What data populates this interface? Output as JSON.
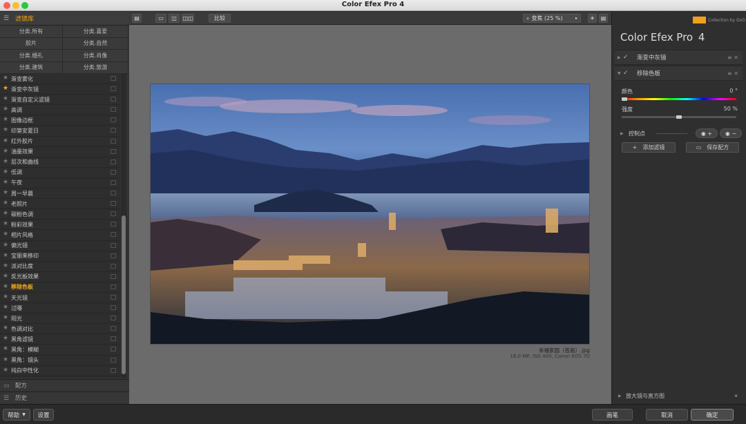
{
  "window": {
    "title": "Color Efex Pro 4"
  },
  "library": {
    "header": "滤镜库",
    "categories": [
      "分类.所有",
      "分类.喜爱",
      "胶片",
      "分类.自然",
      "分类.婚礼",
      "分类.肖像",
      "分类.建筑",
      "分类.旅游"
    ],
    "filters": [
      {
        "name": "渐变雾化",
        "fav": false
      },
      {
        "name": "渐变中灰镜",
        "fav": true
      },
      {
        "name": "渐变自定义滤镜",
        "fav": false
      },
      {
        "name": "高调",
        "fav": false
      },
      {
        "name": "图像边框",
        "fav": false
      },
      {
        "name": "印第安夏日",
        "fav": false
      },
      {
        "name": "红外胶片",
        "fav": false
      },
      {
        "name": "油墨效果",
        "fav": false
      },
      {
        "name": "层次和曲线",
        "fav": false
      },
      {
        "name": "低调",
        "fav": false
      },
      {
        "name": "午夜",
        "fav": false
      },
      {
        "name": "周一早晨",
        "fav": false
      },
      {
        "name": "老照片",
        "fav": false
      },
      {
        "name": "碳粉色调",
        "fav": false
      },
      {
        "name": "粉彩效果",
        "fav": false
      },
      {
        "name": "相片风格",
        "fav": false
      },
      {
        "name": "偏光镜",
        "fav": false
      },
      {
        "name": "宝丽来移印",
        "fav": false
      },
      {
        "name": "派对比度",
        "fav": false
      },
      {
        "name": "反光板效果",
        "fav": false
      },
      {
        "name": "移除色板",
        "fav": false,
        "selected": true
      },
      {
        "name": "天光镜",
        "fav": false
      },
      {
        "name": "过曝",
        "fav": false
      },
      {
        "name": "阳光",
        "fav": false
      },
      {
        "name": "色调对比",
        "fav": false
      },
      {
        "name": "黑角滤镜",
        "fav": false
      },
      {
        "name": "黑角：模糊",
        "fav": false
      },
      {
        "name": "黑角：镜头",
        "fav": false
      },
      {
        "name": "纯白中性化",
        "fav": false
      }
    ],
    "recipes_label": "配方",
    "history_label": "历史"
  },
  "toolbar": {
    "compare_label": "比较",
    "zoom_label": "变焦 (25 %)"
  },
  "image": {
    "filename": "幸福家园（苍南）.jpg",
    "meta": "16.0 MP, ISO 400, Canon EOS 7D"
  },
  "panel": {
    "logo_text": "Collection by DxO",
    "brand": "Color Efex Pro",
    "brand_version": "4",
    "filter1": "渐变中灰镜",
    "filter2": "移除色板",
    "color_label": "颜色",
    "color_value": "0 °",
    "color_level": 0,
    "strength_label": "强度",
    "strength_value": "50 %",
    "strength_level": 0.5,
    "control_points_label": "控制点",
    "add_filter_label": "添加滤镜",
    "save_recipe_label": "保存配方",
    "loupe_label": "放大镜与直方图"
  },
  "footer": {
    "help_label": "帮助",
    "settings_label": "设置",
    "brush_label": "画笔",
    "cancel_label": "取消",
    "ok_label": "确定"
  }
}
